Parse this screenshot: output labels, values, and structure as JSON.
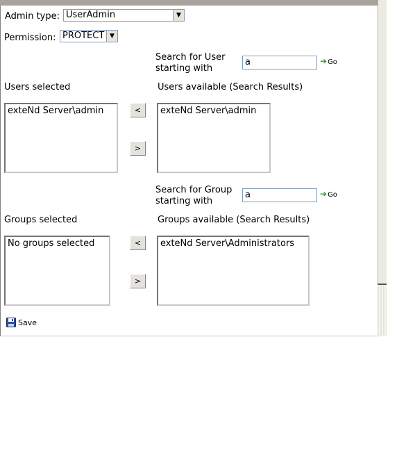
{
  "admin_type": {
    "label": "Admin type:",
    "value": "UserAdmin"
  },
  "permission": {
    "label": "Permission:",
    "value": "PROTECT"
  },
  "user_search": {
    "label_line1": "Search for User",
    "label_line2": "starting with",
    "value": "a",
    "go_label": "Go"
  },
  "users_selected": {
    "label": "Users selected",
    "items": [
      "exteNd Server\\admin"
    ]
  },
  "users_available": {
    "label": "Users available (Search Results)",
    "items": [
      "exteNd Server\\admin"
    ]
  },
  "group_search": {
    "label_line1": "Search for Group",
    "label_line2": "starting with",
    "value": "a",
    "go_label": "Go"
  },
  "groups_selected": {
    "label": "Groups selected",
    "items": [
      "No groups selected"
    ]
  },
  "groups_available": {
    "label": "Groups available (Search Results)",
    "items": [
      "exteNd Server\\Administrators"
    ]
  },
  "move_buttons": {
    "left": "<",
    "right": ">"
  },
  "save": {
    "label": "Save"
  }
}
